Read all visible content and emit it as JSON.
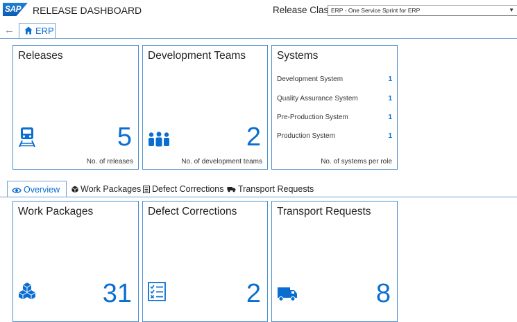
{
  "header": {
    "logo_text": "SAP",
    "app_title": "RELEASE DASHBOARD",
    "release_class_label": "Release Class:",
    "release_class_value": "ERP - One Service Sprint for ERP"
  },
  "nav": {
    "tab_label": "ERP"
  },
  "top_tiles": {
    "releases": {
      "title": "Releases",
      "value": "5",
      "footer": "No. of releases",
      "icon": "train-icon"
    },
    "teams": {
      "title": "Development Teams",
      "value": "2",
      "footer": "No. of development teams",
      "icon": "team-icon"
    },
    "systems": {
      "title": "Systems",
      "footer": "No. of systems per role",
      "rows": [
        {
          "label": "Development System",
          "count": "1"
        },
        {
          "label": "Quality Assurance System",
          "count": "1"
        },
        {
          "label": "Pre-Production System",
          "count": "1"
        },
        {
          "label": "Production System",
          "count": "1"
        }
      ]
    }
  },
  "tabs": [
    {
      "label": "Overview",
      "icon": "eye-icon",
      "active": true
    },
    {
      "label": "Work Packages",
      "icon": "cube-icon",
      "active": false
    },
    {
      "label": "Defect Corrections",
      "icon": "list-icon",
      "active": false
    },
    {
      "label": "Transport Requests",
      "icon": "truck-icon",
      "active": false
    }
  ],
  "bottom_tiles": {
    "work_packages": {
      "title": "Work Packages",
      "value": "31",
      "icon": "cubes-icon"
    },
    "defect_corrections": {
      "title": "Defect Corrections",
      "value": "2",
      "icon": "checklist-icon"
    },
    "transport_requests": {
      "title": "Transport Requests",
      "value": "8",
      "icon": "truck-icon"
    }
  },
  "colors": {
    "accent": "#0a6ed1",
    "tile_border": "#4e8ecb"
  }
}
